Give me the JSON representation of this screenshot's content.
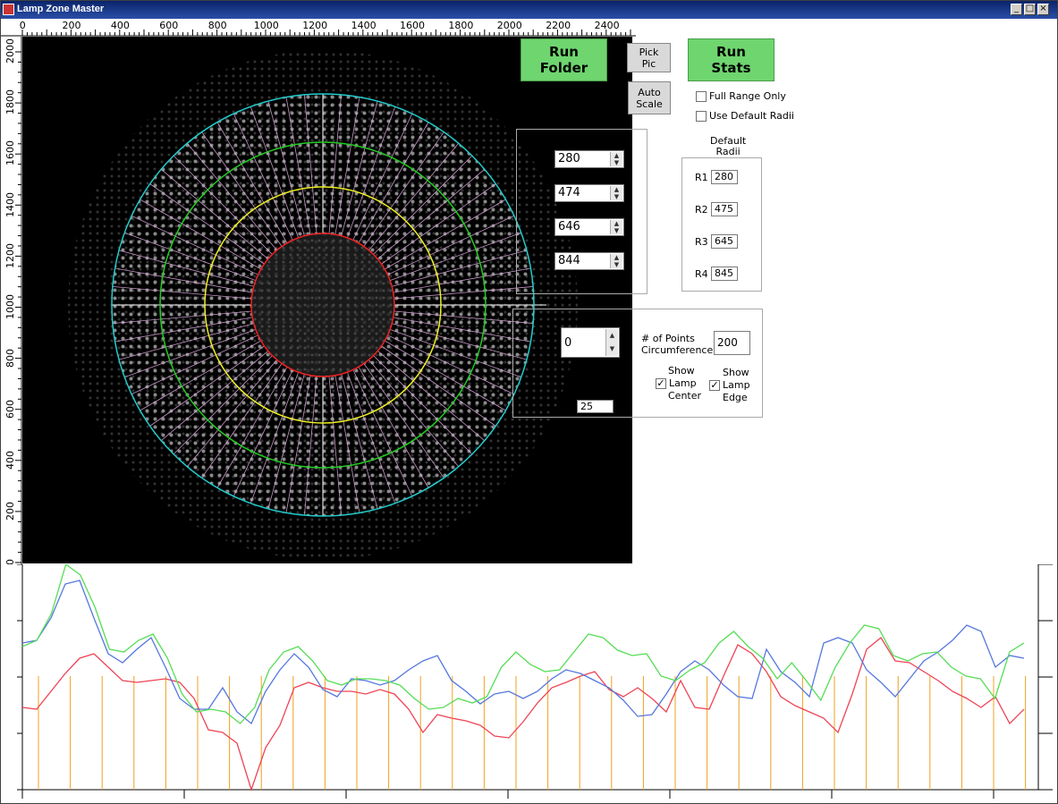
{
  "window": {
    "title": "Lamp Zone Master"
  },
  "ruler_top": [
    "0",
    "200",
    "400",
    "600",
    "800",
    "1000",
    "1200",
    "1400",
    "1600",
    "1800",
    "2000",
    "2200",
    "2400"
  ],
  "ruler_left": [
    "2000",
    "1800",
    "1600",
    "1400",
    "1200",
    "1000",
    "800",
    "600",
    "400",
    "200",
    "0"
  ],
  "buttons": {
    "run_folder": [
      "Run",
      "Folder"
    ],
    "pick_pic": [
      "Pick",
      "Pic"
    ],
    "auto_scale": [
      "Auto",
      "Scale"
    ],
    "run_stats": [
      "Run",
      "Stats"
    ]
  },
  "checkboxes": {
    "full_range_only": "Full Range Only",
    "use_default_radii": "Use Default Radii"
  },
  "radii": {
    "r1": "280",
    "r2": "474",
    "r3": "646",
    "r4": "844"
  },
  "default_radii": {
    "label_1": "Default",
    "label_2": "Radii",
    "items": [
      {
        "label": "R1",
        "value": "280"
      },
      {
        "label": "R2",
        "value": "475"
      },
      {
        "label": "R3",
        "value": "645"
      },
      {
        "label": "R4",
        "value": "845"
      }
    ]
  },
  "lamp_zone": {
    "offset_value": "0",
    "points_label_1": "# of Points",
    "points_label_2": "Circumference",
    "points_value": "200",
    "show_center": [
      "Show",
      "Lamp",
      "Center"
    ],
    "show_edge": [
      "Show",
      "Lamp",
      "Edge"
    ],
    "show_center_checked": true,
    "show_edge_checked": true,
    "thresh_value": "25"
  },
  "graph": {
    "colors": {
      "green": "#55dd55",
      "blue": "#5577dd",
      "red": "#ee4455",
      "marker": "#f0a020"
    }
  }
}
